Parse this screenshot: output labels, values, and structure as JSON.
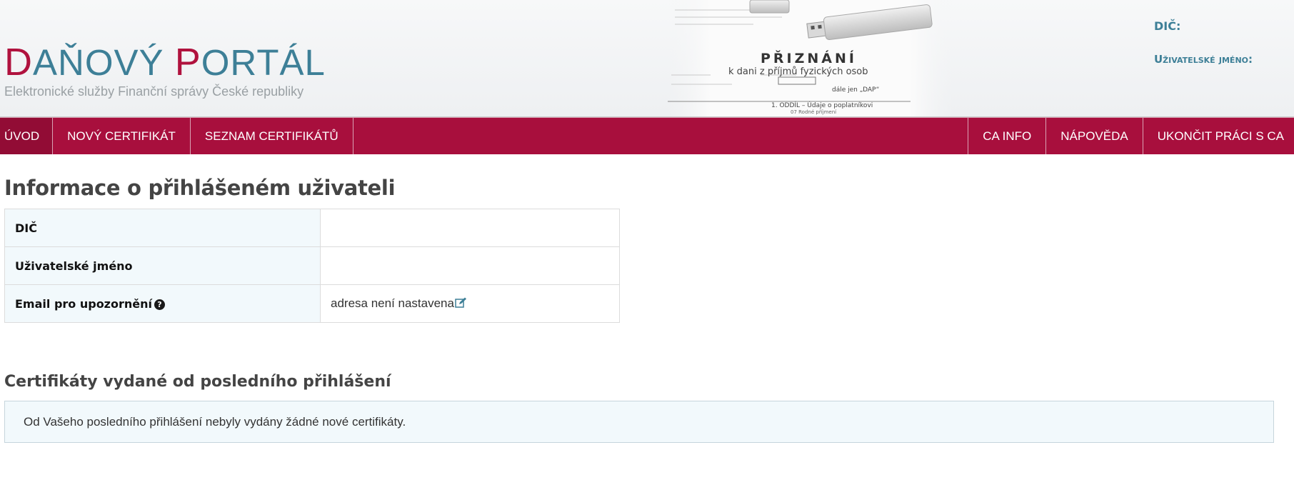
{
  "header": {
    "logo": {
      "first_letter_1": "D",
      "rest_1": "AŇOVÝ ",
      "first_letter_2": "P",
      "rest_2": "ORTÁL"
    },
    "subtitle": "Elektronické služby Finanční správy České republiky",
    "art_text": {
      "heading": "PŘIZNÁNÍ",
      "line1": "k dani z příjmů fyzických osob",
      "line2": "dále jen „DAP“",
      "line3": "1. ODDÍL – Údaje o poplatníkovi",
      "line4": "07 Rodné příjmení"
    },
    "user_info": {
      "dic_label": "DIČ:",
      "username_label": "Uživatelské jméno:"
    }
  },
  "nav": {
    "left": [
      "ÚVOD",
      "NOVÝ CERTIFIKÁT",
      "SEZNAM CERTIFIKÁTŮ"
    ],
    "right": [
      "CA INFO",
      "NÁPOVĚDA",
      "UKONČIT PRÁCI S CA"
    ]
  },
  "main": {
    "title": "Informace o přihlášeném uživateli",
    "rows": [
      {
        "label": "DIČ",
        "value": ""
      },
      {
        "label": "Uživatelské jméno",
        "value": ""
      },
      {
        "label": "Email pro upozornění",
        "value": "adresa není nastavena"
      }
    ],
    "certs_title": "Certifikáty vydané od posledního přihlášení",
    "certs_notice": "Od Vašeho posledního přihlášení nebyly vydány žádné nové certifikáty."
  },
  "colors": {
    "brand": "#a80f3d",
    "accent": "#3d7f97",
    "panel": "#f2f9fc"
  },
  "icons": {
    "help": "question-circle-icon",
    "edit": "edit-pencil-icon"
  }
}
